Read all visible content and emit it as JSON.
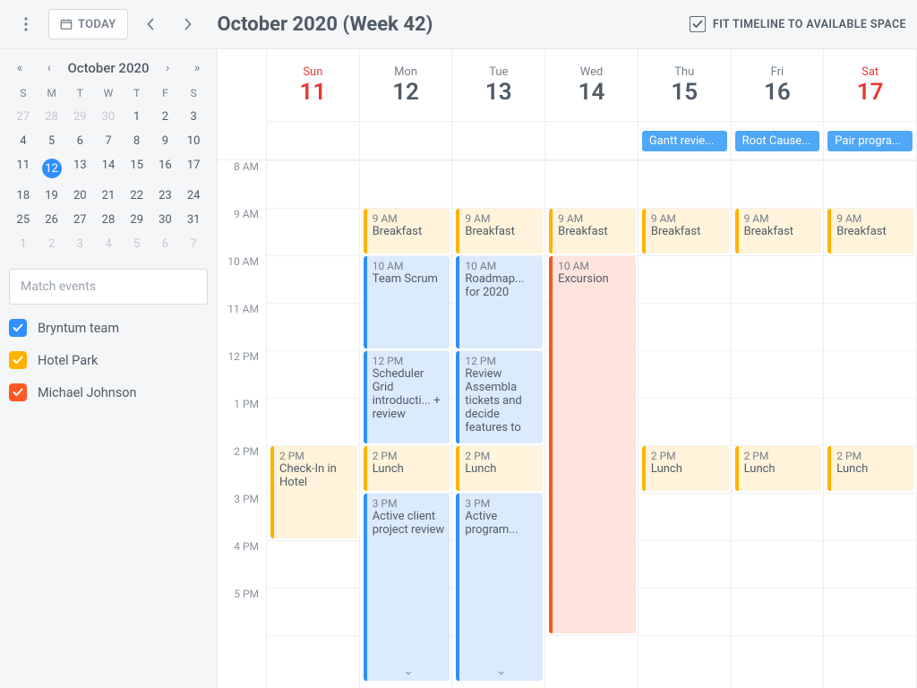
{
  "topbar": {
    "today": "TODAY",
    "title": "October 2020 (Week 42)",
    "fit": "FIT TIMELINE TO AVAILABLE SPACE"
  },
  "mini": {
    "title": "October 2020",
    "dow": [
      "S",
      "M",
      "T",
      "W",
      "T",
      "F",
      "S"
    ],
    "days": [
      {
        "n": 27,
        "o": 1
      },
      {
        "n": 28,
        "o": 1
      },
      {
        "n": 29,
        "o": 1
      },
      {
        "n": 30,
        "o": 1
      },
      {
        "n": 1
      },
      {
        "n": 2
      },
      {
        "n": 3
      },
      {
        "n": 4
      },
      {
        "n": 5
      },
      {
        "n": 6
      },
      {
        "n": 7
      },
      {
        "n": 8
      },
      {
        "n": 9
      },
      {
        "n": 10
      },
      {
        "n": 11
      },
      {
        "n": 12,
        "sel": 1
      },
      {
        "n": 13
      },
      {
        "n": 14
      },
      {
        "n": 15
      },
      {
        "n": 16
      },
      {
        "n": 17
      },
      {
        "n": 18
      },
      {
        "n": 19
      },
      {
        "n": 20
      },
      {
        "n": 21
      },
      {
        "n": 22
      },
      {
        "n": 23
      },
      {
        "n": 24
      },
      {
        "n": 25
      },
      {
        "n": 26
      },
      {
        "n": 27
      },
      {
        "n": 28
      },
      {
        "n": 29
      },
      {
        "n": 30
      },
      {
        "n": 31
      },
      {
        "n": 1,
        "o": 1
      },
      {
        "n": 2,
        "o": 1
      },
      {
        "n": 3,
        "o": 1
      },
      {
        "n": 4,
        "o": 1
      },
      {
        "n": 5,
        "o": 1
      },
      {
        "n": 6,
        "o": 1
      },
      {
        "n": 7,
        "o": 1
      }
    ]
  },
  "filter": {
    "placeholder": "Match events"
  },
  "resources": [
    {
      "label": "Bryntum team",
      "color": "blue"
    },
    {
      "label": "Hotel Park",
      "color": "amber"
    },
    {
      "label": "Michael Johnson",
      "color": "orange"
    }
  ],
  "hours": [
    "8 AM",
    "9 AM",
    "10 AM",
    "11 AM",
    "12 PM",
    "1 PM",
    "2 PM",
    "3 PM",
    "4 PM",
    "5 PM"
  ],
  "days": [
    {
      "dow": "Sun",
      "num": "11",
      "wkend": 1,
      "allday": null,
      "events": [
        {
          "t": "2 PM",
          "title": "Check-In in Hotel",
          "start": 6,
          "dur": 2,
          "c": "amber"
        }
      ]
    },
    {
      "dow": "Mon",
      "num": "12",
      "allday": null,
      "events": [
        {
          "t": "9 AM",
          "title": "Breakfast",
          "start": 1,
          "dur": 1,
          "c": "amber"
        },
        {
          "t": "10 AM",
          "title": "Team Scrum",
          "start": 2,
          "dur": 2,
          "c": "blue"
        },
        {
          "t": "12 PM",
          "title": "Scheduler Grid introducti... + review",
          "start": 4,
          "dur": 2,
          "c": "blue"
        },
        {
          "t": "2 PM",
          "title": "Lunch",
          "start": 6,
          "dur": 1,
          "c": "amber"
        },
        {
          "t": "3 PM",
          "title": "Active client project review",
          "start": 7,
          "dur": 4,
          "c": "blue",
          "more": 1
        }
      ]
    },
    {
      "dow": "Tue",
      "num": "13",
      "allday": null,
      "events": [
        {
          "t": "9 AM",
          "title": "Breakfast",
          "start": 1,
          "dur": 1,
          "c": "amber"
        },
        {
          "t": "10 AM",
          "title": "Roadmap... for 2020",
          "start": 2,
          "dur": 2,
          "c": "blue"
        },
        {
          "t": "12 PM",
          "title": "Review Assembla tickets and decide features to",
          "start": 4,
          "dur": 2,
          "c": "blue"
        },
        {
          "t": "2 PM",
          "title": "Lunch",
          "start": 6,
          "dur": 1,
          "c": "amber"
        },
        {
          "t": "3 PM",
          "title": "Active program...",
          "start": 7,
          "dur": 4,
          "c": "blue",
          "more": 1
        }
      ]
    },
    {
      "dow": "Wed",
      "num": "14",
      "allday": null,
      "events": [
        {
          "t": "9 AM",
          "title": "Breakfast",
          "start": 1,
          "dur": 1,
          "c": "amber"
        },
        {
          "t": "10 AM",
          "title": "Excursion",
          "start": 2,
          "dur": 8,
          "c": "orange"
        }
      ]
    },
    {
      "dow": "Thu",
      "num": "15",
      "allday": "Gantt revie...",
      "events": [
        {
          "t": "9 AM",
          "title": "Breakfast",
          "start": 1,
          "dur": 1,
          "c": "amber"
        },
        {
          "t": "2 PM",
          "title": "Lunch",
          "start": 6,
          "dur": 1,
          "c": "amber"
        }
      ]
    },
    {
      "dow": "Fri",
      "num": "16",
      "allday": "Root Cause...",
      "events": [
        {
          "t": "9 AM",
          "title": "Breakfast",
          "start": 1,
          "dur": 1,
          "c": "amber"
        },
        {
          "t": "2 PM",
          "title": "Lunch",
          "start": 6,
          "dur": 1,
          "c": "amber"
        }
      ]
    },
    {
      "dow": "Sat",
      "num": "17",
      "wkend": 1,
      "allday": "Pair progra...",
      "events": [
        {
          "t": "9 AM",
          "title": "Breakfast",
          "start": 1,
          "dur": 1,
          "c": "amber"
        },
        {
          "t": "2 PM",
          "title": "Lunch",
          "start": 6,
          "dur": 1,
          "c": "amber"
        }
      ]
    }
  ]
}
